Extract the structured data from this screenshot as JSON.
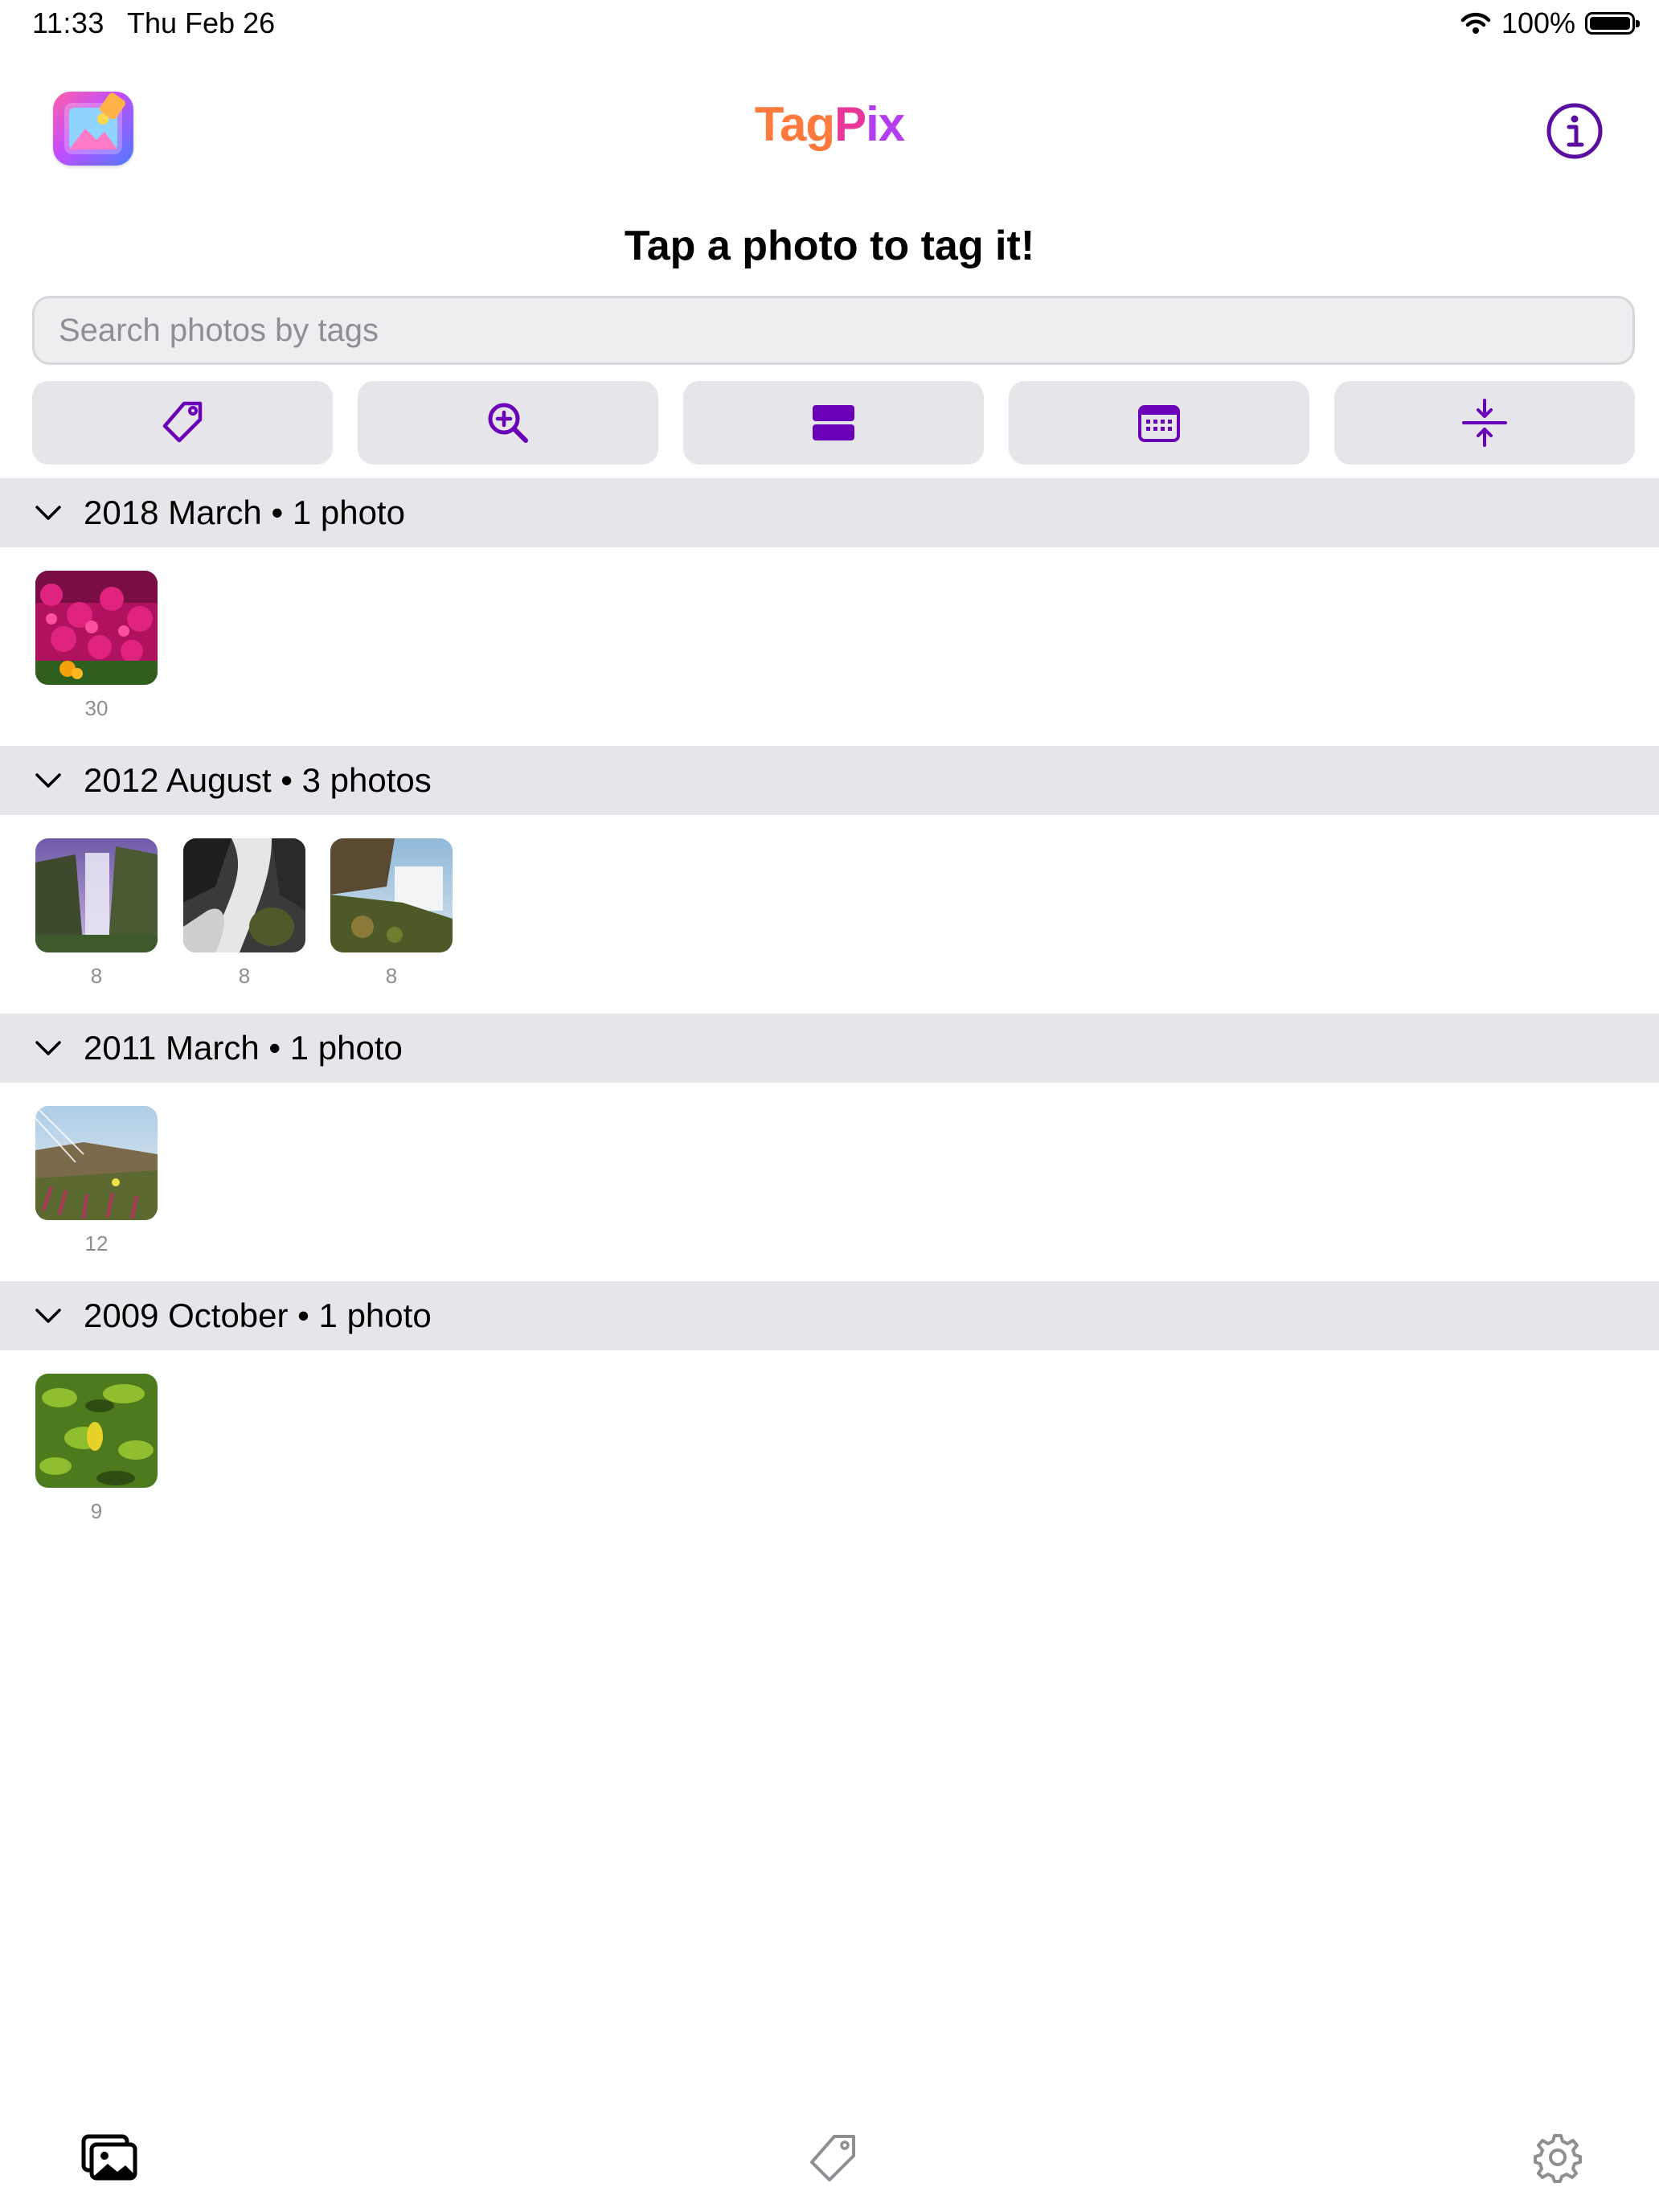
{
  "status_bar": {
    "time": "11:33",
    "date": "Thu Feb 26",
    "battery": "100%"
  },
  "header": {
    "app_title_parts": [
      "Tag",
      "P",
      "ix"
    ],
    "headline": "Tap a photo to tag it!"
  },
  "search": {
    "placeholder": "Search photos by tags"
  },
  "toolbar": {
    "buttons": [
      "tag-icon",
      "zoom-in-icon",
      "list-layout-icon",
      "calendar-icon",
      "collapse-icon"
    ],
    "accent_color": "#6a00b8"
  },
  "sections": [
    {
      "title": "2018 March • 1 photo",
      "photos": [
        {
          "count": "30"
        }
      ]
    },
    {
      "title": "2012 August • 3 photos",
      "photos": [
        {
          "count": "8"
        },
        {
          "count": "8"
        },
        {
          "count": "8"
        }
      ]
    },
    {
      "title": "2011 March • 1 photo",
      "photos": [
        {
          "count": "12"
        }
      ]
    },
    {
      "title": "2009 October • 1 photo",
      "photos": [
        {
          "count": "9"
        }
      ]
    }
  ],
  "tab_bar": {
    "items": [
      "photos-icon",
      "tag-icon",
      "gear-icon"
    ]
  }
}
